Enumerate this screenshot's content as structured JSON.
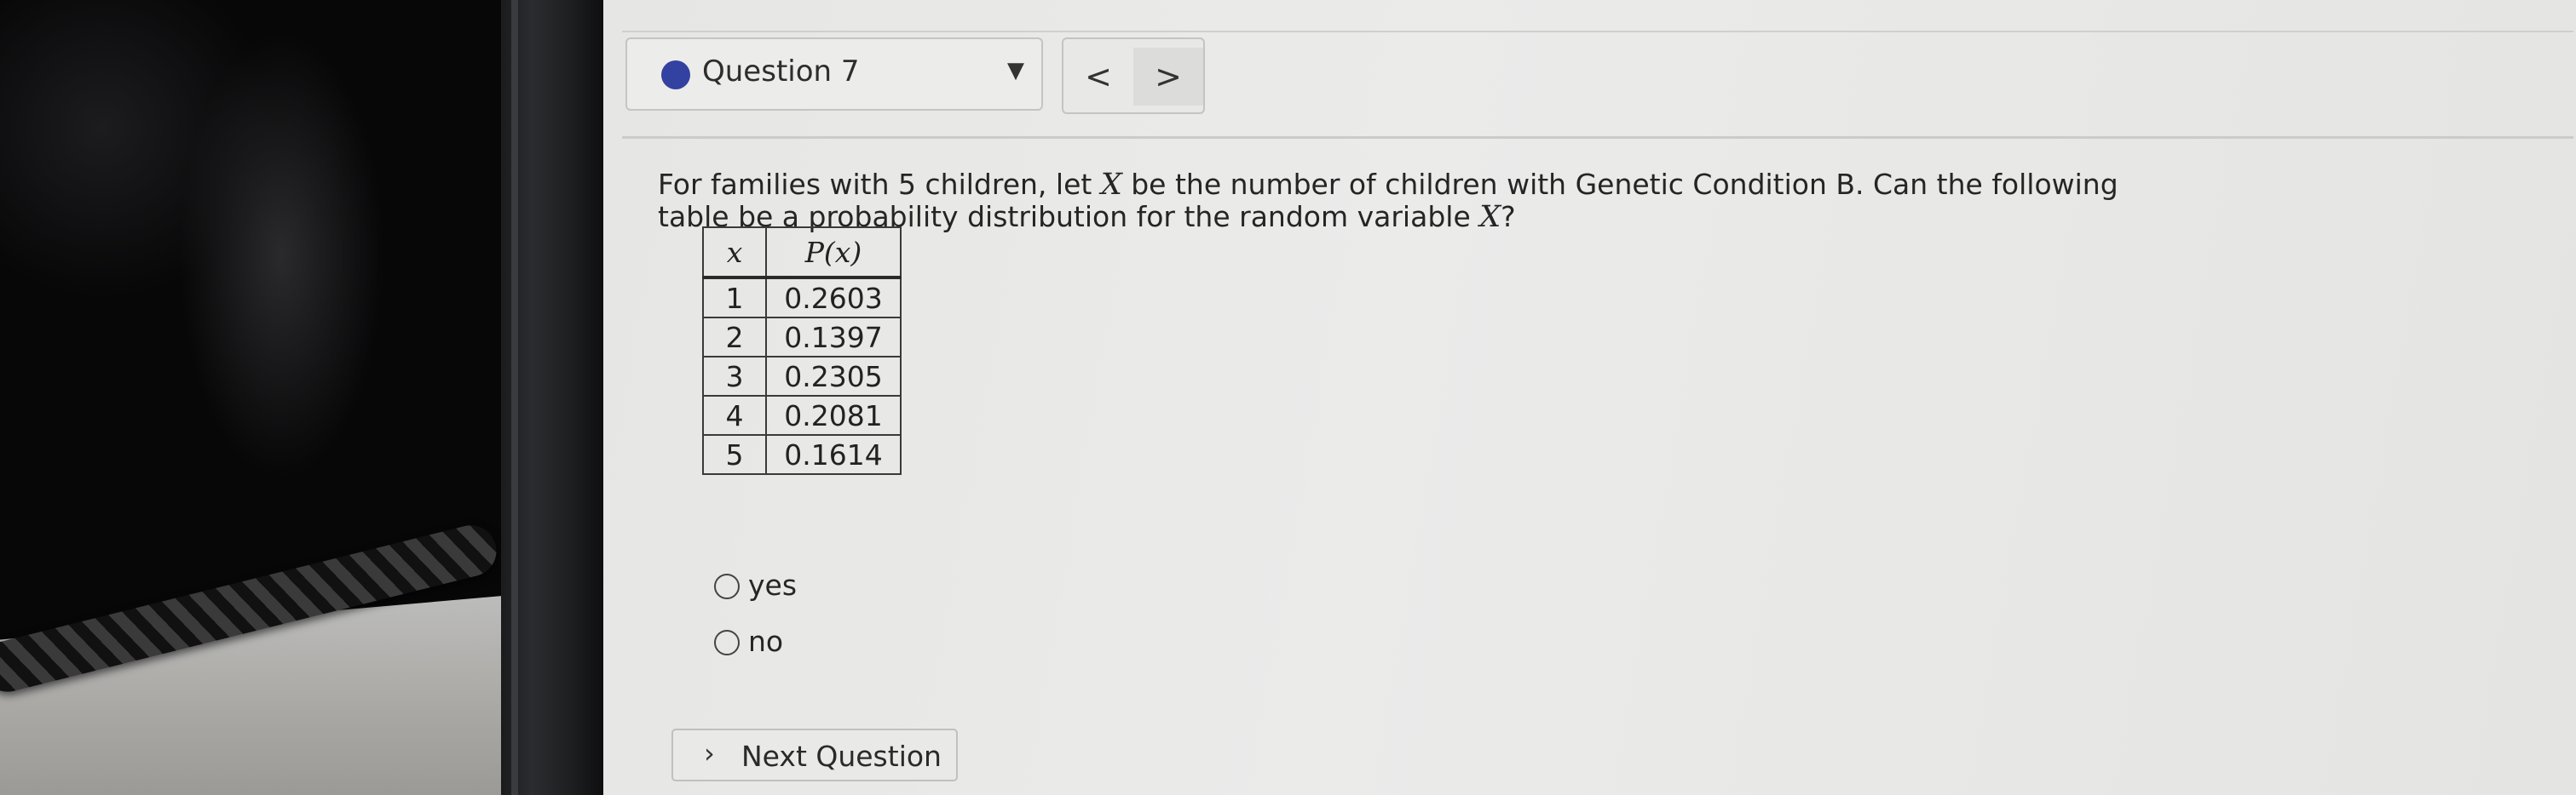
{
  "question_selector": {
    "label": "Question 7",
    "caret": "▼",
    "status_color": "#3341a0"
  },
  "nav": {
    "prev": "<",
    "next": ">"
  },
  "question": {
    "part1": "For families with 5 children, let ",
    "var1": "X",
    "part2": " be the number of children with Genetic Condition B. Can the following table be a probability distribution for the random variable ",
    "var2": "X",
    "part3": "?"
  },
  "table": {
    "headers": [
      "x",
      "P(x)"
    ],
    "rows": [
      [
        "1",
        "0.2603"
      ],
      [
        "2",
        "0.1397"
      ],
      [
        "3",
        "0.2305"
      ],
      [
        "4",
        "0.2081"
      ],
      [
        "5",
        "0.1614"
      ]
    ]
  },
  "options": [
    "yes",
    "no"
  ],
  "next_button": {
    "chevron": "›",
    "label": "Next Question"
  }
}
